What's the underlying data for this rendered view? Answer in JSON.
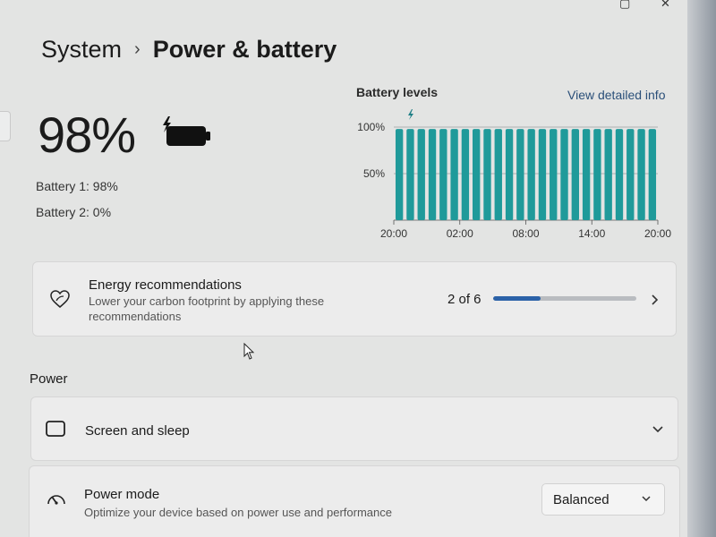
{
  "breadcrumb": {
    "parent": "System",
    "separator": "›",
    "current": "Power & battery"
  },
  "battery": {
    "percent_label": "98%",
    "percent": 98,
    "battery1": "Battery 1: 98%",
    "battery2": "Battery 2: 0%"
  },
  "chart_data": {
    "type": "bar",
    "title": "Battery levels",
    "link": "View detailed info",
    "y_ticks": [
      "100%",
      "50%"
    ],
    "x_ticks": [
      "20:00",
      "02:00",
      "08:00",
      "14:00",
      "20:00"
    ],
    "ylim": [
      0,
      100
    ],
    "bar_count": 24,
    "values": [
      98,
      98,
      98,
      98,
      98,
      98,
      98,
      98,
      98,
      98,
      98,
      98,
      98,
      98,
      98,
      98,
      98,
      98,
      98,
      98,
      98,
      98,
      98,
      98
    ],
    "bar_color": "#1f9a9a"
  },
  "energy": {
    "title": "Energy recommendations",
    "subtitle": "Lower your carbon footprint by applying these recommendations",
    "progress_label": "2 of 6",
    "completed": 2,
    "total": 6
  },
  "power_section": {
    "header": "Power"
  },
  "screen_sleep": {
    "title": "Screen and sleep"
  },
  "power_mode": {
    "title": "Power mode",
    "subtitle": "Optimize your device based on power use and performance",
    "selected": "Balanced"
  },
  "colors": {
    "accent": "#2b62a8",
    "chart": "#1f9a9a",
    "background": "#e3e4e3"
  }
}
